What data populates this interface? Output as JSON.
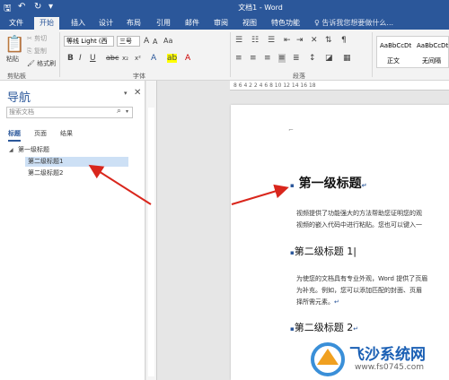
{
  "window": {
    "title": "文档1 - Word"
  },
  "tabs": [
    "文件",
    "开始",
    "插入",
    "设计",
    "布局",
    "引用",
    "邮件",
    "审阅",
    "视图",
    "特色功能"
  ],
  "tellme": "♀ 告诉我您想要做什么...",
  "ribbon": {
    "paste_label": "粘贴",
    "cut": "剪切",
    "copy": "复制",
    "format_painter": "格式刷",
    "clipboard_group": "剪贴板",
    "font_name": "等线 Light (西",
    "font_size": "三号",
    "font_group": "字体",
    "paragraph_group": "段落",
    "styles": [
      {
        "preview": "AaBbCcDt",
        "name": "正文"
      },
      {
        "preview": "AaBbCcDt",
        "name": "无间隔"
      }
    ]
  },
  "nav": {
    "title": "导航",
    "search_placeholder": "搜索文档",
    "tabs": [
      "标题",
      "页面",
      "结果"
    ],
    "tree": [
      {
        "label": "第一级标题",
        "level": 1,
        "selected": false
      },
      {
        "label": "第二级标题1",
        "level": 2,
        "selected": true
      },
      {
        "label": "第二级标题2",
        "level": 2,
        "selected": false
      }
    ]
  },
  "ruler_h": "8  6  4  2     2  4  6  8  10  12  14  16  18",
  "doc": {
    "h1": "第一级标题",
    "p1_line1": "视频提供了功能强大的方法帮助您证明您的观",
    "p1_line2": "视频的嵌入代码中进行粘贴。您也可以键入一",
    "h2a": "第二级标题 1",
    "p2_line1": "为使您的文档具有专业外观，Word 提供了页眉",
    "p2_line2": "为补充。例如，您可以添加匹配的封面、页眉",
    "p2_line3": "择所需元素。",
    "h2b": "第二级标题 2"
  },
  "watermark": {
    "text": "飞沙系统网",
    "url": "www.fs0745.com"
  },
  "colors": {
    "accent": "#2b579a",
    "arrow": "#d9261c"
  }
}
